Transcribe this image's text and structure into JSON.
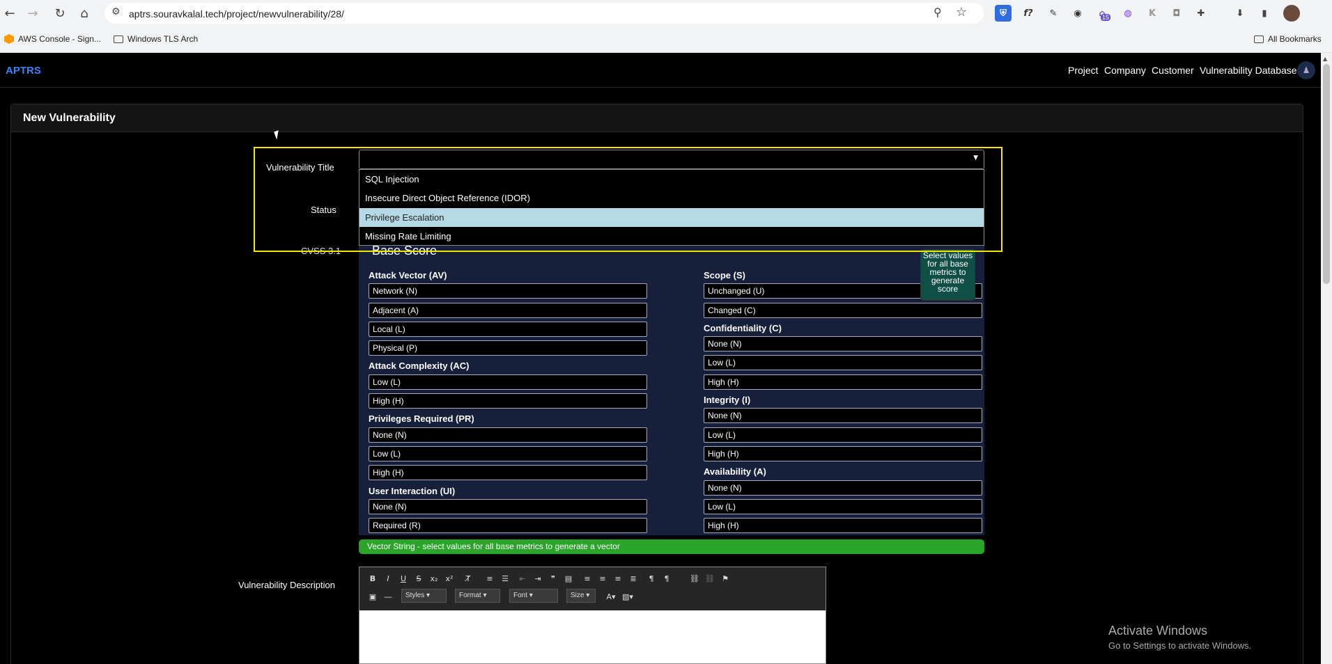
{
  "browser": {
    "url": "aptrs.souravkalal.tech/project/newvulnerability/28/",
    "extension_badge": "15",
    "bookmarks": [
      "AWS Console - Sign...",
      "Windows TLS Arch"
    ],
    "all_bookmarks": "All Bookmarks"
  },
  "navbar": {
    "brand": "APTRS",
    "items": [
      "Project",
      "Company",
      "Customer",
      "Vulnerability Database"
    ]
  },
  "page": {
    "title": "New Vulnerability"
  },
  "form": {
    "vulnerability_title_label": "Vulnerability Title",
    "status_label": "Status",
    "cvss_label": "CVSS 3.1",
    "description_label": "Vulnerability Description",
    "title_options": [
      "SQL Injection",
      "Insecure Direct Object Reference (IDOR)",
      "Privilege Escalation",
      "Missing Rate Limiting"
    ],
    "highlighted_option": "Privilege Escalation"
  },
  "cvss": {
    "heading": "Base Score",
    "tooltip": "Select values for all base metrics to generate score",
    "left_metrics": [
      {
        "title": "Attack Vector (AV)",
        "options": [
          "Network (N)",
          "Adjacent (A)",
          "Local (L)",
          "Physical (P)"
        ]
      },
      {
        "title": "Attack Complexity (AC)",
        "options": [
          "Low (L)",
          "High (H)"
        ]
      },
      {
        "title": "Privileges Required (PR)",
        "options": [
          "None (N)",
          "Low (L)",
          "High (H)"
        ]
      },
      {
        "title": "User Interaction (UI)",
        "options": [
          "None (N)",
          "Required (R)"
        ]
      }
    ],
    "right_metrics": [
      {
        "title": "Scope (S)",
        "options": [
          "Unchanged (U)",
          "Changed (C)"
        ]
      },
      {
        "title": "Confidentiality (C)",
        "options": [
          "None (N)",
          "Low (L)",
          "High (H)"
        ]
      },
      {
        "title": "Integrity (I)",
        "options": [
          "None (N)",
          "Low (L)",
          "High (H)"
        ]
      },
      {
        "title": "Availability (A)",
        "options": [
          "None (N)",
          "Low (L)",
          "High (H)"
        ]
      }
    ],
    "vector_string": "Vector String - select values for all base metrics to generate a vector"
  },
  "editor": {
    "styles": "Styles",
    "format": "Format",
    "font": "Font",
    "size": "Size"
  },
  "watermark": {
    "line1": "Activate Windows",
    "line2": "Go to Settings to activate Windows."
  }
}
